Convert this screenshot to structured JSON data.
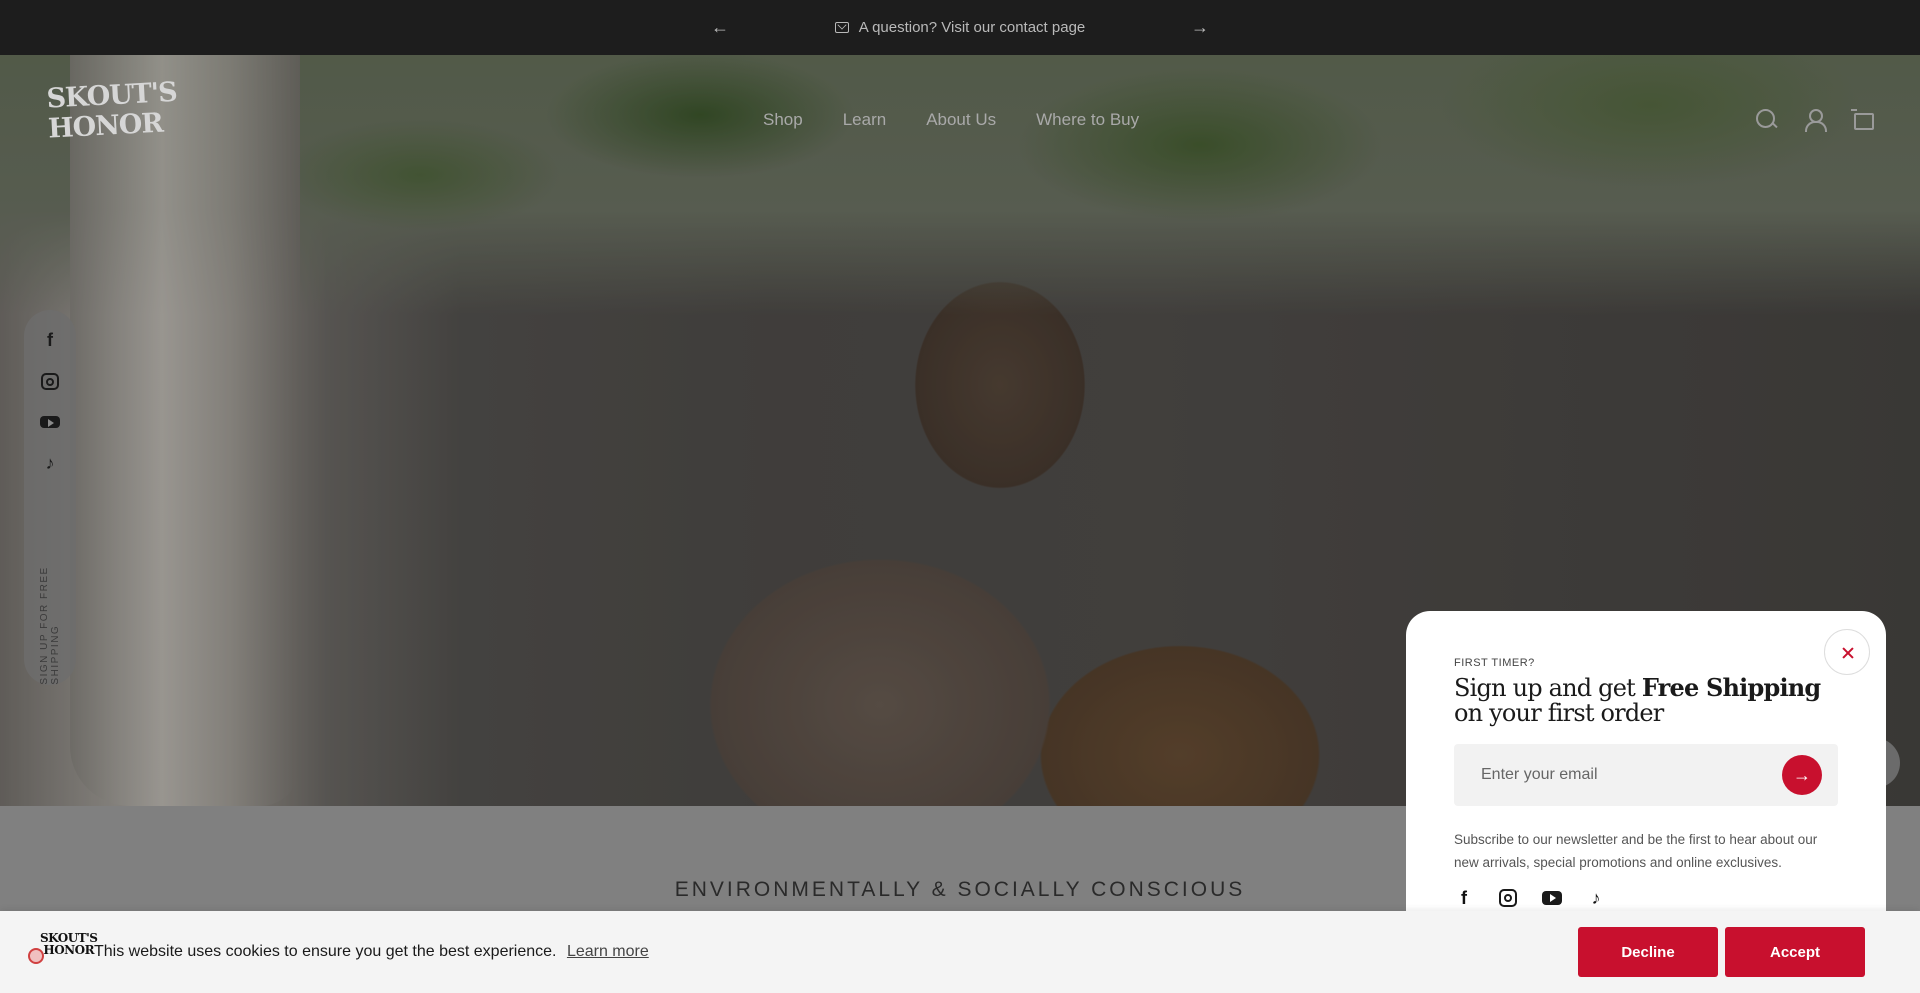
{
  "announcement": {
    "message": "A question? Visit our contact page",
    "prev_icon": "arrow-left-icon",
    "next_icon": "arrow-right-icon",
    "mail_icon": "mail-icon"
  },
  "header": {
    "logo_line1": "SKOUT'S",
    "logo_line2": "HONOR",
    "nav": [
      "Shop",
      "Learn",
      "About Us",
      "Where to Buy"
    ],
    "icons": [
      "search-icon",
      "account-icon",
      "cart-icon"
    ]
  },
  "social_rail": {
    "icons": [
      "facebook-icon",
      "instagram-icon",
      "youtube-icon",
      "tiktok-icon"
    ],
    "cta": "SIGN UP FOR FREE SHIPPING"
  },
  "section": {
    "heading": "ENVIRONMENTALLY & SOCIALLY CONSCIOUS"
  },
  "popup": {
    "eyebrow": "FIRST TIMER?",
    "headline_pre": "Sign up and get ",
    "headline_bold": "Free Shipping",
    "headline_post": " on your first order",
    "email_placeholder": "Enter your email",
    "subscribe_text": "Subscribe to our newsletter and be the first to hear about our new arrivals, special promotions and online exclusives.",
    "accent_color": "#c8102e"
  },
  "cookie": {
    "text": "This website uses cookies to ensure you get the best experience.",
    "learn_more": "Learn more",
    "decline": "Decline",
    "accept": "Accept"
  }
}
